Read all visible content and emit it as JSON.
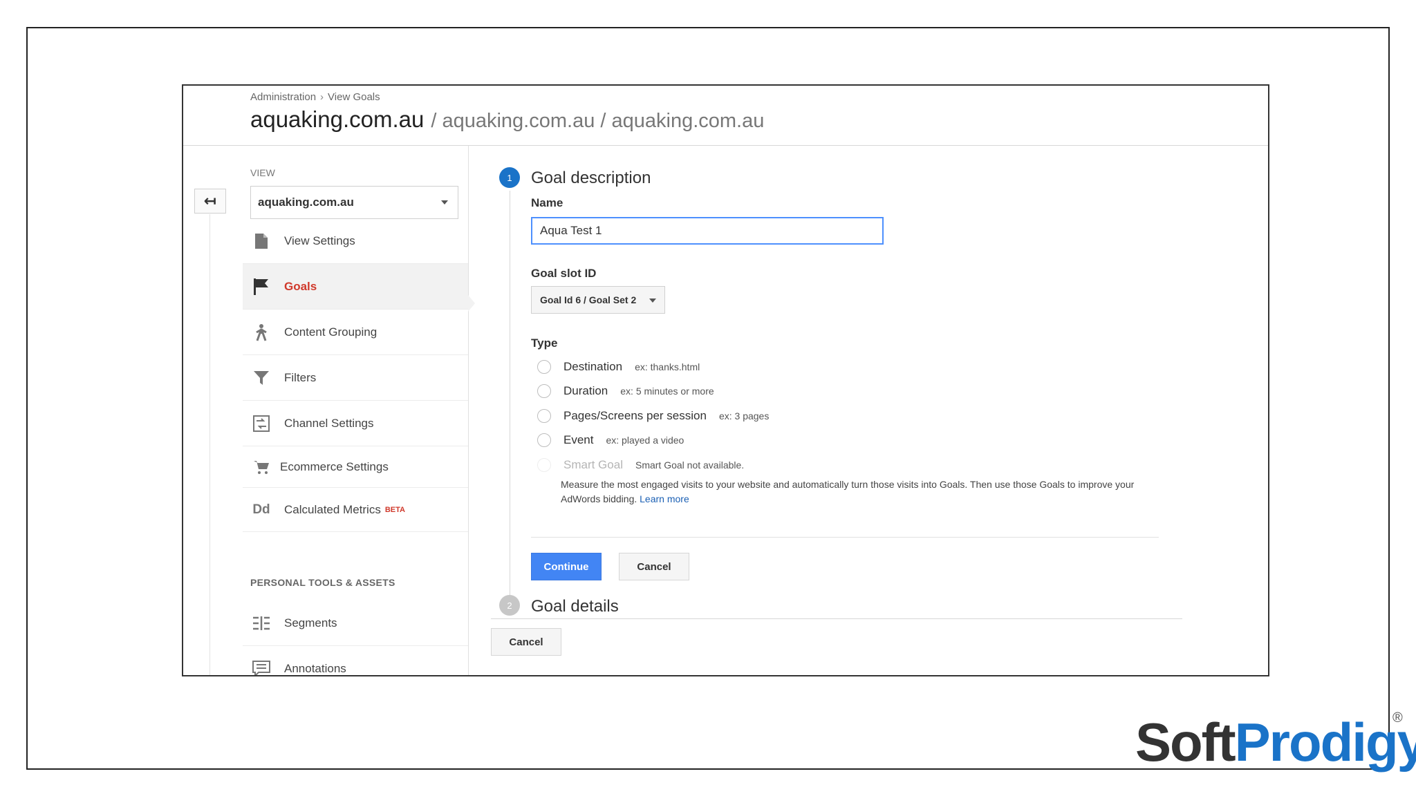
{
  "breadcrumb": {
    "items": [
      "Administration",
      "View Goals"
    ],
    "separator": "›"
  },
  "header": {
    "title": "aquaking.com.au",
    "subtitle": "/ aquaking.com.au / aquaking.com.au"
  },
  "view_selector": {
    "label": "VIEW",
    "selected": "aquaking.com.au"
  },
  "nav": {
    "items": [
      {
        "label": "View Settings",
        "icon": "document-icon"
      },
      {
        "label": "Goals",
        "icon": "flag-icon",
        "active": true
      },
      {
        "label": "Content Grouping",
        "icon": "person-walking-icon"
      },
      {
        "label": "Filters",
        "icon": "filter-icon"
      },
      {
        "label": "Channel Settings",
        "icon": "channel-icon"
      },
      {
        "label": "Ecommerce Settings",
        "icon": "cart-icon"
      },
      {
        "label": "Calculated Metrics",
        "icon": "dd-icon",
        "badge": "BETA"
      }
    ],
    "section_personal": "PERSONAL TOOLS & ASSETS",
    "personal_items": [
      {
        "label": "Segments",
        "icon": "segments-icon"
      },
      {
        "label": "Annotations",
        "icon": "annotation-icon"
      }
    ]
  },
  "step1": {
    "number": "1",
    "title": "Goal description",
    "name_label": "Name",
    "name_value": "Aqua Test 1",
    "slot_label": "Goal slot ID",
    "slot_value": "Goal Id 6 / Goal Set 2",
    "type_label": "Type",
    "types": [
      {
        "label": "Destination",
        "hint": "ex: thanks.html"
      },
      {
        "label": "Duration",
        "hint": "ex: 5 minutes or more"
      },
      {
        "label": "Pages/Screens per session",
        "hint": "ex: 3 pages"
      },
      {
        "label": "Event",
        "hint": "ex: played a video"
      }
    ],
    "smart_goal": {
      "label": "Smart Goal",
      "hint": "Smart Goal not available.",
      "description": "Measure the most engaged visits to your website and automatically turn those visits into Goals. Then use those Goals to improve your AdWords bidding.",
      "link": "Learn more"
    },
    "continue_label": "Continue",
    "cancel_label": "Cancel"
  },
  "step2": {
    "number": "2",
    "title": "Goal details"
  },
  "footer_cancel_label": "Cancel",
  "logo": {
    "part1": "Soft",
    "part2": "Prodigy",
    "reg": "®"
  },
  "colors": {
    "accent": "#4285f4",
    "step_active": "#1a73c8",
    "nav_active": "#d0392b",
    "logo_blue": "#1a73c8"
  }
}
